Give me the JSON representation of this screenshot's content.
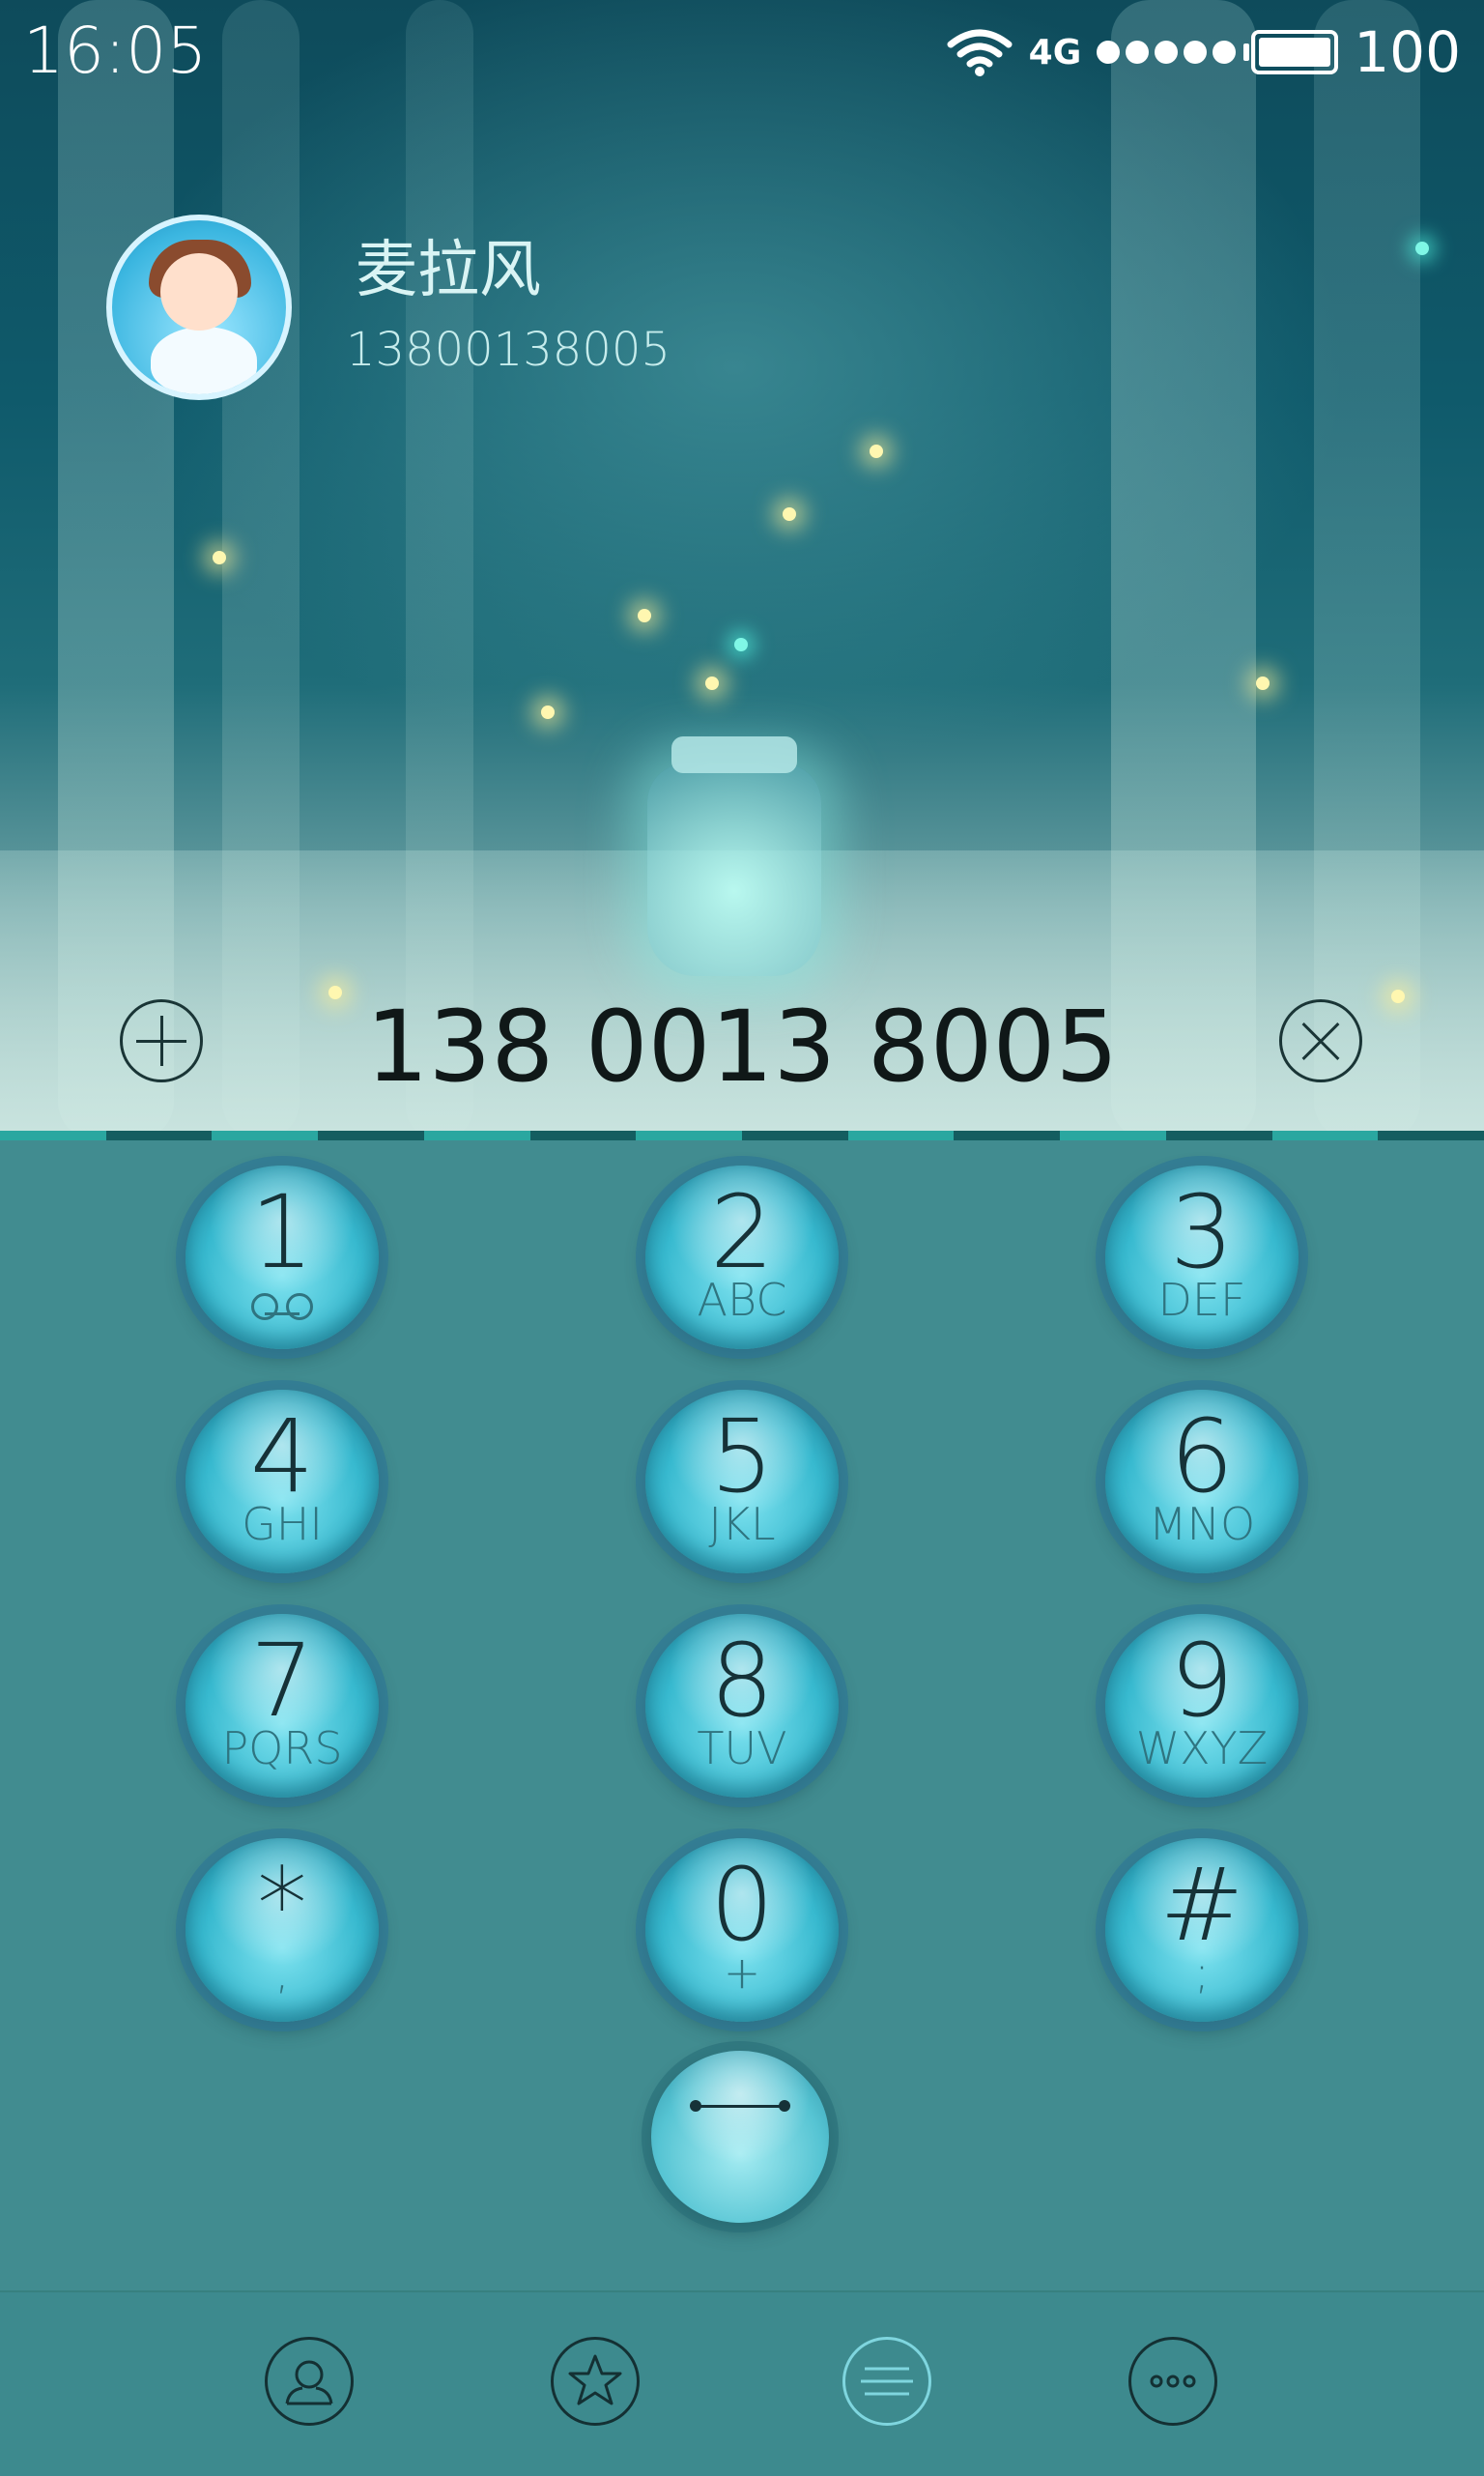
{
  "status_bar": {
    "time": "16:05",
    "network": "4G",
    "signal_bars": 5,
    "battery": "100"
  },
  "contact": {
    "name": "麦拉风",
    "number": "13800138005"
  },
  "dialer": {
    "number_display": "138 0013 8005"
  },
  "keypad": {
    "keys": [
      {
        "digit": "1",
        "letters": ""
      },
      {
        "digit": "2",
        "letters": "ABC"
      },
      {
        "digit": "3",
        "letters": "DEF"
      },
      {
        "digit": "4",
        "letters": "GHI"
      },
      {
        "digit": "5",
        "letters": "JKL"
      },
      {
        "digit": "6",
        "letters": "MNO"
      },
      {
        "digit": "7",
        "letters": "PQRS"
      },
      {
        "digit": "8",
        "letters": "TUV"
      },
      {
        "digit": "9",
        "letters": "WXYZ"
      },
      {
        "digit": "*",
        "letters": ","
      },
      {
        "digit": "0",
        "letters": "+"
      },
      {
        "digit": "#",
        "letters": ";"
      }
    ]
  },
  "tabs": [
    {
      "name": "contacts",
      "icon": "contacts-icon",
      "active": false
    },
    {
      "name": "favorites",
      "icon": "star-icon",
      "active": false
    },
    {
      "name": "dialer",
      "icon": "menu-lines-icon",
      "active": true
    },
    {
      "name": "more",
      "icon": "more-dots-icon",
      "active": false
    }
  ],
  "colors": {
    "keypad_bg": "#418c90",
    "key_face": "#37b9cf",
    "active_tab": "#7fd6df"
  }
}
